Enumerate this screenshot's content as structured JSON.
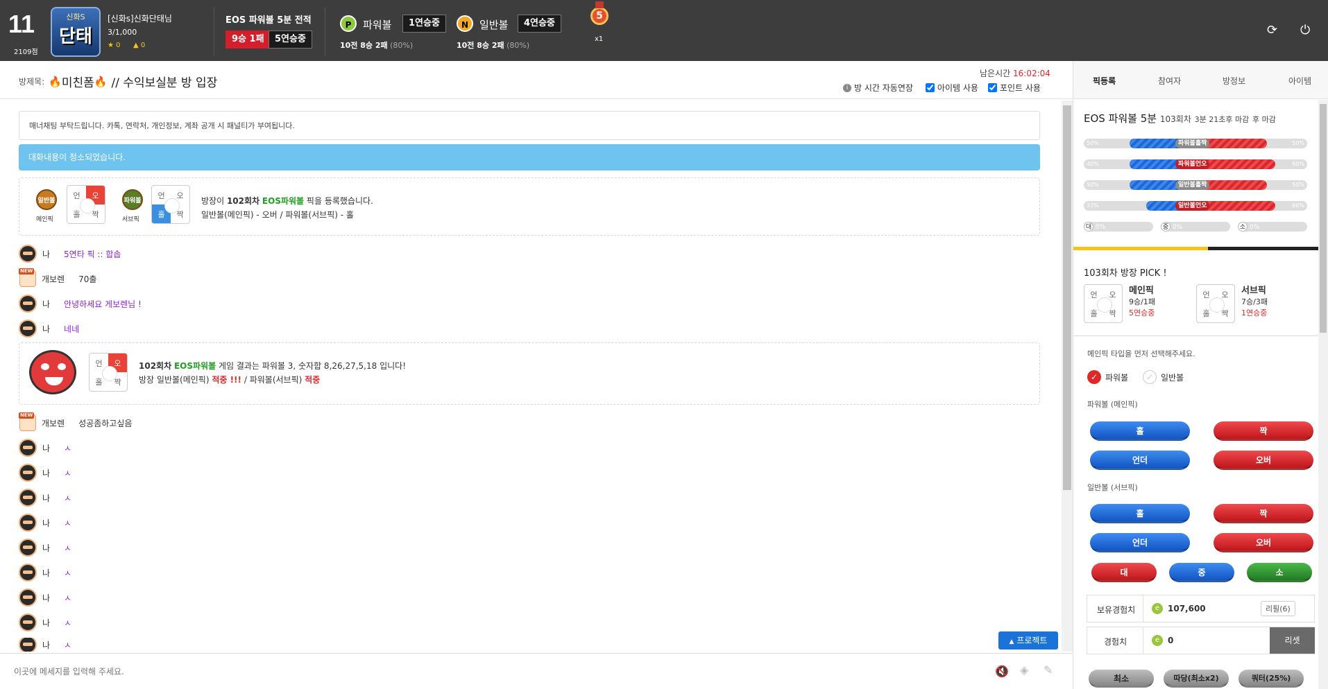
{
  "header": {
    "level": "11",
    "points": "2109점",
    "avatar_text": "단태",
    "avatar_small": "신화S",
    "username": "[신화s]신화단태님",
    "exp": "3/1,000",
    "star_count": "0",
    "like_count": "0",
    "record_title": "EOS 파워볼 5분 전적",
    "record_wl": "9승 1패",
    "record_streak": "5연승중",
    "powerball_icon": "P",
    "powerball_label": "파워볼",
    "powerball_streak": "1연승중",
    "powerball_stat": "10전 8승 2패",
    "powerball_pct": "(80%)",
    "normal_icon": "N",
    "normal_label": "일반볼",
    "normal_streak": "4연승중",
    "normal_stat": "10전 8승 2패",
    "normal_pct": "(80%)",
    "medal_num": "5",
    "medal_mult": "x1"
  },
  "room": {
    "title_label": "방제목:",
    "title_text": "미친폼",
    "title_rest": "// 수익보실분 방 입장",
    "remain_label": "남은시간",
    "remain_time": "16:02:04",
    "opt_extend": "방 시간 자동연장",
    "opt_item": "아이템 사용",
    "opt_point": "포인트 사용"
  },
  "tabs": [
    "픽등록",
    "참여자",
    "방정보",
    "아이템"
  ],
  "chat": {
    "notice": "매너채팅 부탁드립니다. 카톡, 연락처, 개인정보, 계좌 공개 시 패널티가 부여됩니다.",
    "cleared": "대화내용이 청소되었습니다.",
    "pick_ball1": "일반볼",
    "pick_ball1_label": "메인픽",
    "pick_ball2": "파워볼",
    "pick_ball2_label": "서브픽",
    "grid": [
      "언",
      "오",
      "홀",
      "짝"
    ],
    "pick_line1_a": "방장이",
    "pick_line1_b": "102회차",
    "pick_line1_c": "EOS파워볼",
    "pick_line1_d": "픽을 등록했습니다.",
    "pick_line2": "일반볼(메인픽) - 오버 / 파워볼(서브픽) - 홀",
    "messages": [
      {
        "type": "me",
        "name": "나",
        "text": "5연타 픽 :: 합솝"
      },
      {
        "type": "other",
        "name": "개보렌",
        "text": "70출"
      },
      {
        "type": "me",
        "name": "나",
        "text": "안녕하세요 게보렌님 !"
      },
      {
        "type": "me",
        "name": "나",
        "text": "네네"
      }
    ],
    "result_line1_a": "102회차",
    "result_line1_b": "EOS파워볼",
    "result_line1_c": "게임 결과는 파워볼 3, 숫자합 8,26,27,5,18 입니다!",
    "result_line2_a": "방장 일반볼(메인픽)",
    "result_line2_b": "적중 !!!",
    "result_line2_c": "/ 파워볼(서브픽)",
    "result_line2_d": "적중",
    "messages2": [
      {
        "type": "other",
        "name": "개보렌",
        "text": "성공좀하고싶음"
      },
      {
        "type": "me",
        "name": "나",
        "text": "ㅅ"
      },
      {
        "type": "me",
        "name": "나",
        "text": "ㅅ"
      },
      {
        "type": "me",
        "name": "나",
        "text": "ㅅ"
      },
      {
        "type": "me",
        "name": "나",
        "text": "ㅅ"
      },
      {
        "type": "me",
        "name": "나",
        "text": "ㅅ"
      },
      {
        "type": "me",
        "name": "나",
        "text": "ㅅ"
      },
      {
        "type": "me",
        "name": "나",
        "text": "ㅅ"
      },
      {
        "type": "me",
        "name": "나",
        "text": "ㅅ"
      },
      {
        "type": "me",
        "name": "나",
        "text": "ㅅ"
      }
    ],
    "project_btn": "프로젝트",
    "input_placeholder": "이곳에 메세지를 입력해 주세요."
  },
  "right": {
    "game_title": "EOS 파워볼 5분",
    "round": "103회차",
    "deadline": "3분 21초후 마감",
    "deadline_suffix": "후 마감",
    "gauges": [
      {
        "label": "파워볼홀짝",
        "left": "50%",
        "right": "50%",
        "blue": 0.5,
        "active": false
      },
      {
        "label": "파워볼언오",
        "left": "40%",
        "right": "60%",
        "blue": 0.4,
        "active": true
      },
      {
        "label": "일반볼홀짝",
        "left": "50%",
        "right": "50%",
        "blue": 0.5,
        "active": false
      },
      {
        "label": "일반볼언오",
        "left": "33%",
        "right": "66%",
        "blue": 0.33,
        "active": true
      }
    ],
    "mini": [
      {
        "label": "대",
        "pct": "0%"
      },
      {
        "label": "중",
        "pct": "0%"
      },
      {
        "label": "소",
        "pct": "0%"
      }
    ],
    "host_pick_title": "103회차 방장 PICK !",
    "main_pick": {
      "title": "메인픽",
      "record": "9승/1패",
      "streak": "5연승중"
    },
    "sub_pick": {
      "title": "서브픽",
      "record": "7승/3패",
      "streak": "1연승중"
    },
    "select_prompt": "메인픽 타입을 먼저 선택해주세요.",
    "type_power": "파워볼",
    "type_normal": "일반볼",
    "section_power": "파워볼 (메인픽)",
    "section_normal": "일반볼 (서브픽)",
    "btn_odd": "홀",
    "btn_even": "짝",
    "btn_under": "언더",
    "btn_over": "오버",
    "btn_big": "대",
    "btn_mid": "중",
    "btn_small": "소",
    "exp_label": "보유경험치",
    "exp_value": "107,600",
    "exp_btn": "리필(6)",
    "bet_label": "경험치",
    "bet_value": "0",
    "reset_btn": "리셋",
    "bottom_btns": [
      "최소",
      "따당(최소x2)",
      "쿼터(25%)"
    ]
  },
  "colors": {
    "header_bg": "#3d3d3d",
    "accent_red": "#d21f2b",
    "accent_blue": "#1f67d6",
    "purple": "#8b1ee0",
    "green": "#1f9e1f",
    "cleared_bg": "#6ec3ef"
  }
}
